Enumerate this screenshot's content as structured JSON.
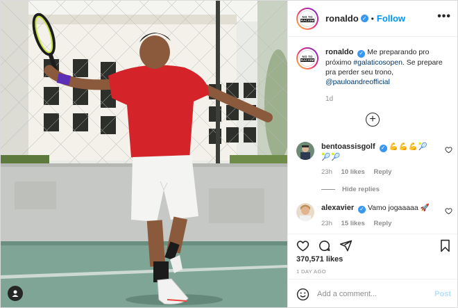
{
  "post": {
    "username": "ronaldo",
    "follow_label": "Follow",
    "separator": "•",
    "more_label": "•••",
    "avatar_logo_line1": "NO TO",
    "avatar_logo_line2": "RACISM"
  },
  "caption": {
    "username": "ronaldo",
    "text_before": "Me preparando pro próximo ",
    "hashtag": "#galaticosopen",
    "text_after": ". Se prepare pra perder seu trono, ",
    "mention": "@pauloandreofficial",
    "time": "1d"
  },
  "load_more_label": "+",
  "comments": [
    {
      "username": "bentoassisgolf",
      "text": "💪💪💪🎾🎾🎾",
      "time": "23h",
      "likes": "10 likes",
      "reply_label": "Reply"
    },
    {
      "username": "alexavier",
      "text": "Vamo jogaaaaa 🚀",
      "time": "23h",
      "likes": "15 likes",
      "reply_label": "Reply"
    }
  ],
  "hide_replies_label": "Hide replies",
  "actions": {
    "likes_count": "370,571 likes",
    "post_time": "1 DAY AGO"
  },
  "add_comment": {
    "placeholder": "Add a comment...",
    "post_label": "Post"
  },
  "colors": {
    "accent": "#0095f6",
    "verified": "#3897f0",
    "muted": "#8e8e8e",
    "post_disabled": "#b2dffc"
  },
  "icons": [
    "heart-icon",
    "comment-icon",
    "share-icon",
    "bookmark-icon",
    "smile-icon",
    "plus-circle-icon",
    "verified-icon",
    "user-tag-icon"
  ]
}
